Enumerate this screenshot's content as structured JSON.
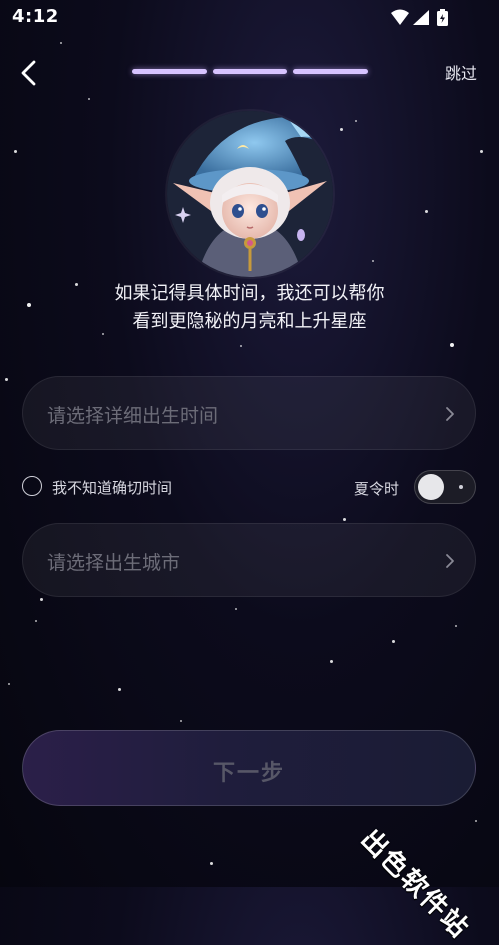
{
  "status_bar": {
    "time": "4:12",
    "icons": [
      "wifi-icon",
      "signal-icon",
      "battery-charging-icon"
    ]
  },
  "header": {
    "back_icon": "chevron-left-icon",
    "progress_steps_total": 3,
    "progress_steps_done": 3,
    "skip_label": "跳过"
  },
  "avatar": {
    "icon": "elf-wizard-avatar"
  },
  "intro": {
    "line1": "如果记得具体时间，我还可以帮你",
    "line2": "看到更隐秘的月亮和上升星座"
  },
  "time_field": {
    "placeholder": "请选择详细出生时间",
    "icon": "chevron-right-icon"
  },
  "unknown_time": {
    "label": "我不知道确切时间",
    "checked": false
  },
  "dst": {
    "label": "夏令时",
    "on": false
  },
  "city_field": {
    "placeholder": "请选择出生城市",
    "icon": "chevron-right-icon"
  },
  "next_button": {
    "label": "下一步",
    "enabled": false
  },
  "watermark": {
    "text": "出色软件站"
  },
  "colors": {
    "accent_progress": "#d7c3ff",
    "background": "#0c0b1c",
    "placeholder": "#6c6c78"
  }
}
